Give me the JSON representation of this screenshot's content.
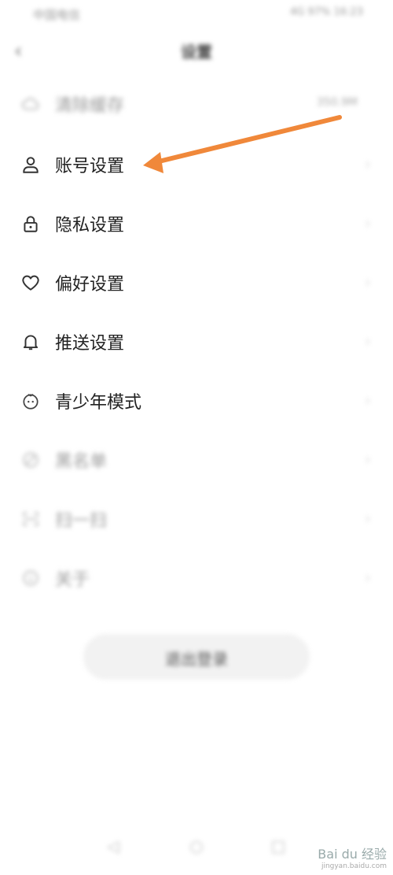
{
  "status_bar": {
    "left": "中国电信",
    "right": "4G 97% 16:23"
  },
  "header": {
    "back_icon": "back-arrow-icon",
    "title": "设置"
  },
  "settings": {
    "items": [
      {
        "label": "清除缓存",
        "icon": "cloud-icon",
        "value": "350.9M"
      },
      {
        "label": "账号设置",
        "icon": "user-icon"
      },
      {
        "label": "隐私设置",
        "icon": "lock-icon"
      },
      {
        "label": "偏好设置",
        "icon": "heart-icon"
      },
      {
        "label": "推送设置",
        "icon": "bell-icon"
      },
      {
        "label": "青少年模式",
        "icon": "teen-mode-icon"
      },
      {
        "label": "黑名单",
        "icon": "blocklist-icon"
      },
      {
        "label": "扫一扫",
        "icon": "scan-icon"
      },
      {
        "label": "关于",
        "icon": "info-icon"
      }
    ]
  },
  "logout": {
    "label": "退出登录"
  },
  "annotation": {
    "color": "#f0883a"
  },
  "watermark": {
    "brand": "Bai du 经验",
    "url": "jingyan.baidu.com"
  }
}
